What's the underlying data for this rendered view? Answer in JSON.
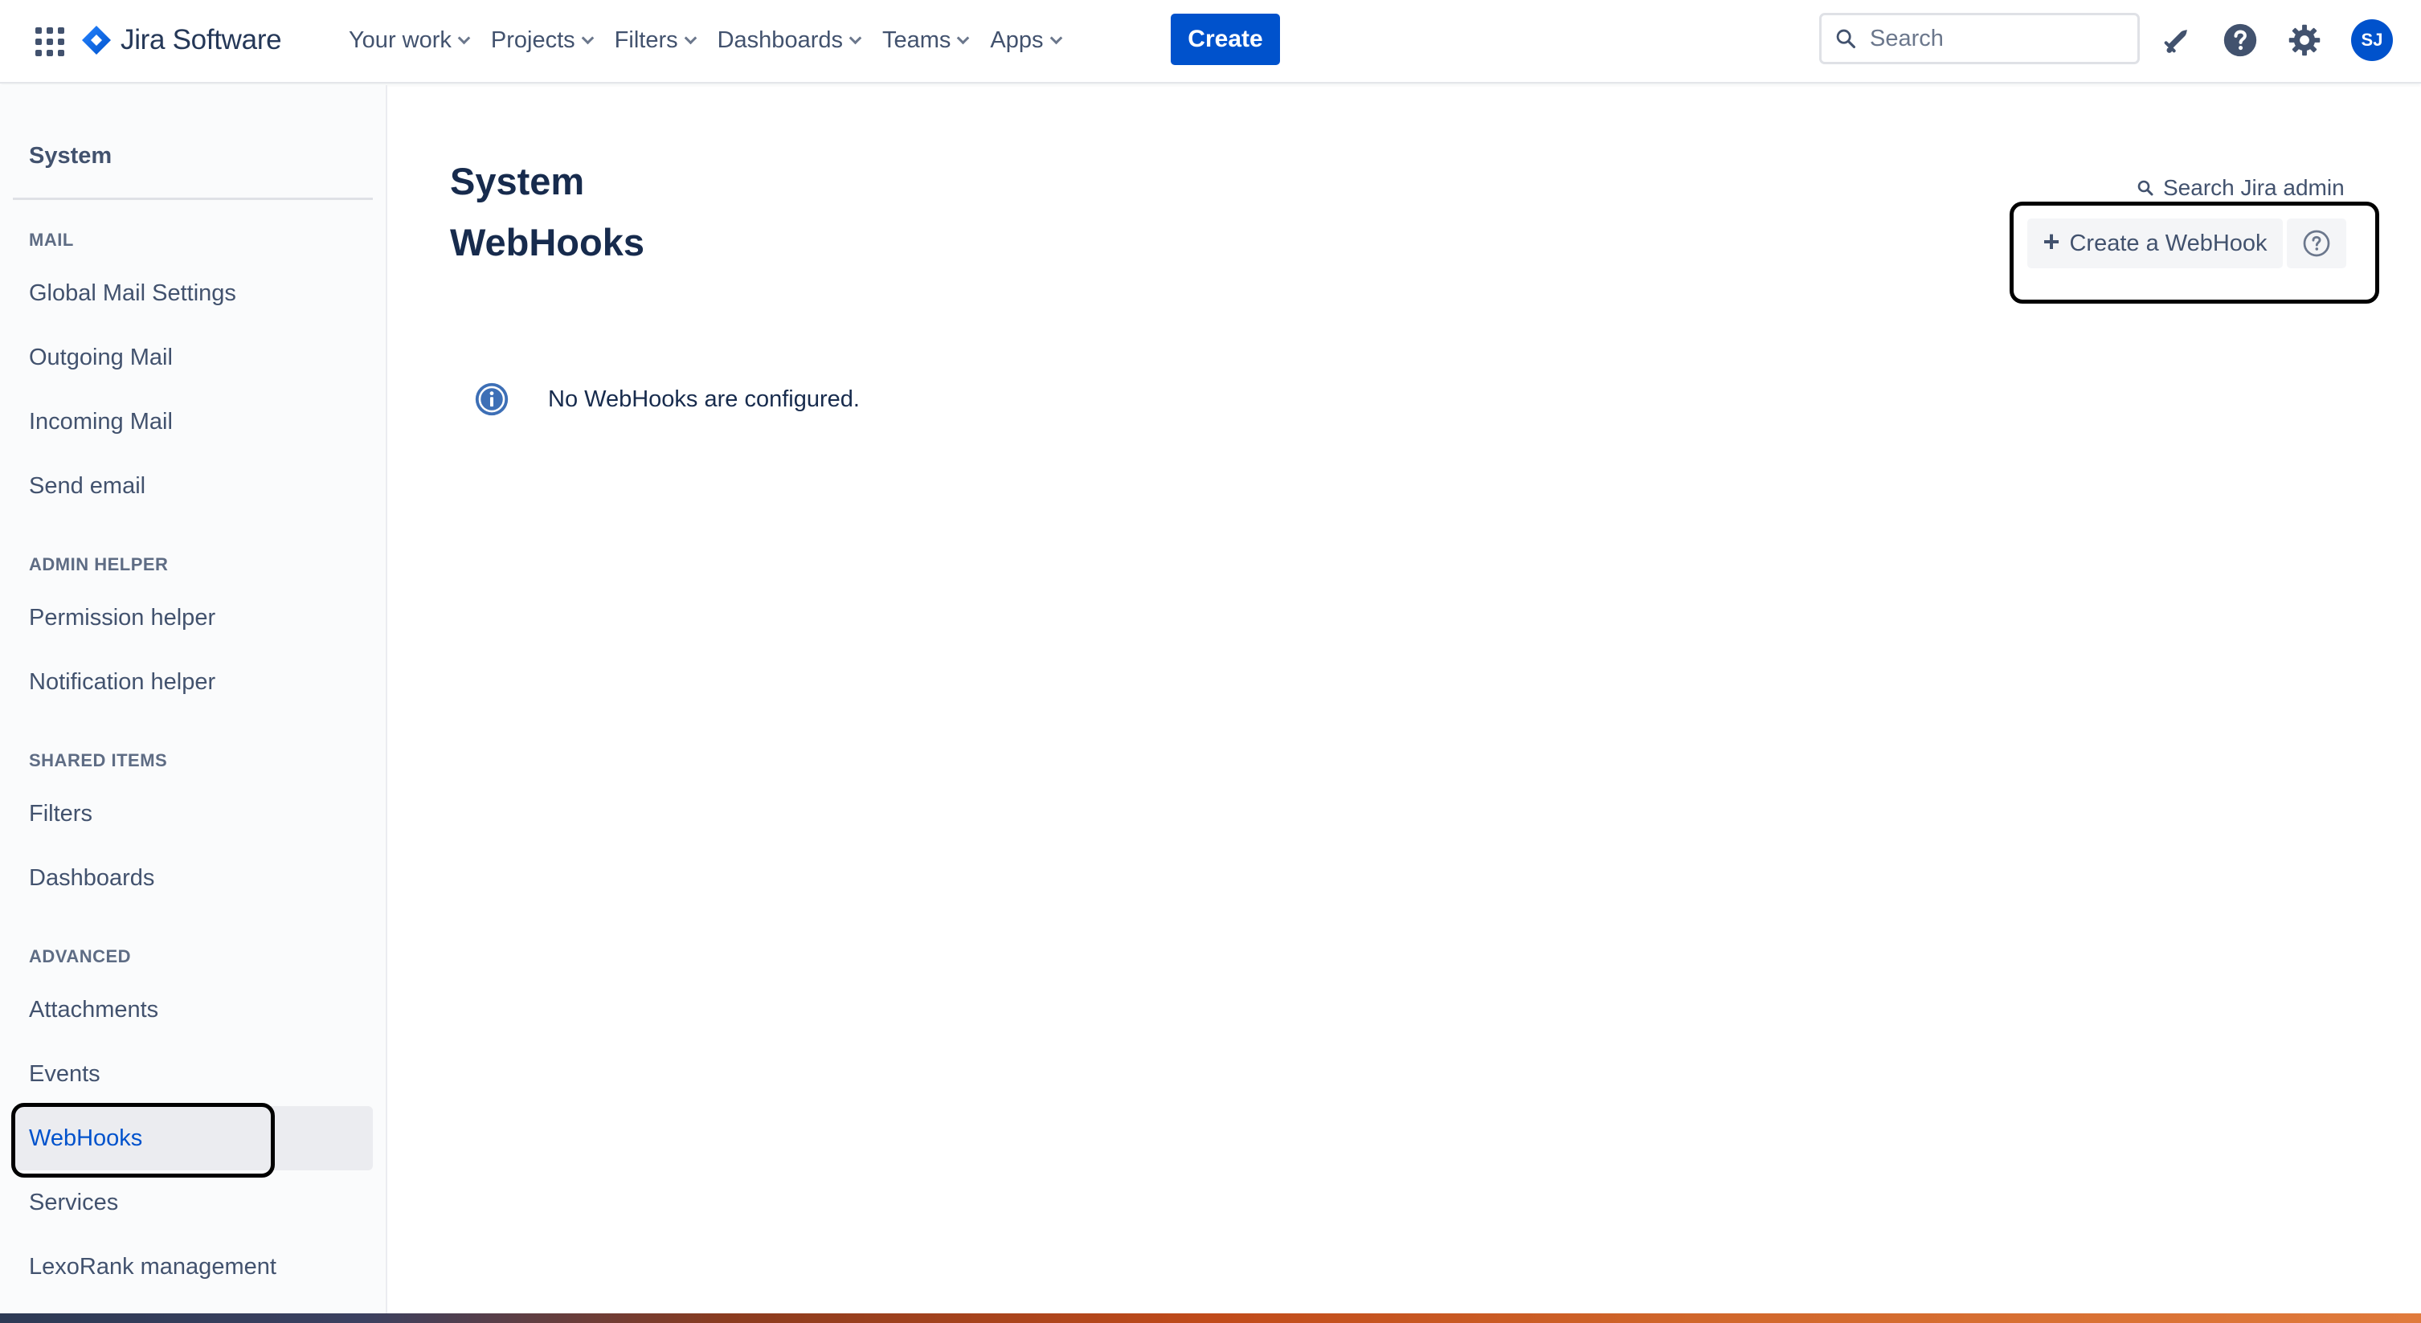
{
  "app": {
    "logo_text": "Jira Software",
    "brand_color": "#0052cc"
  },
  "topnav": {
    "items": [
      {
        "label": "Your work"
      },
      {
        "label": "Projects"
      },
      {
        "label": "Filters"
      },
      {
        "label": "Dashboards"
      },
      {
        "label": "Teams"
      },
      {
        "label": "Apps"
      }
    ],
    "create_label": "Create",
    "search_placeholder": "Search",
    "avatar_initials": "SJ",
    "icons": [
      "apps-grid-icon",
      "notifications-icon",
      "help-icon",
      "settings-icon"
    ]
  },
  "sidebar": {
    "title": "System",
    "sections": [
      {
        "heading": "MAIL",
        "items": [
          "Global Mail Settings",
          "Outgoing Mail",
          "Incoming Mail",
          "Send email"
        ]
      },
      {
        "heading": "ADMIN HELPER",
        "items": [
          "Permission helper",
          "Notification helper"
        ]
      },
      {
        "heading": "SHARED ITEMS",
        "items": [
          "Filters",
          "Dashboards"
        ]
      },
      {
        "heading": "ADVANCED",
        "items": [
          "Attachments",
          "Events",
          "WebHooks",
          "Services",
          "LexoRank management"
        ]
      }
    ],
    "active_item": "WebHooks"
  },
  "main": {
    "title_line1": "System",
    "title_line2": "WebHooks",
    "search_admin_label": "Search Jira admin",
    "create_webhook_label": "Create a WebHook",
    "empty_message": "No WebHooks are configured."
  }
}
